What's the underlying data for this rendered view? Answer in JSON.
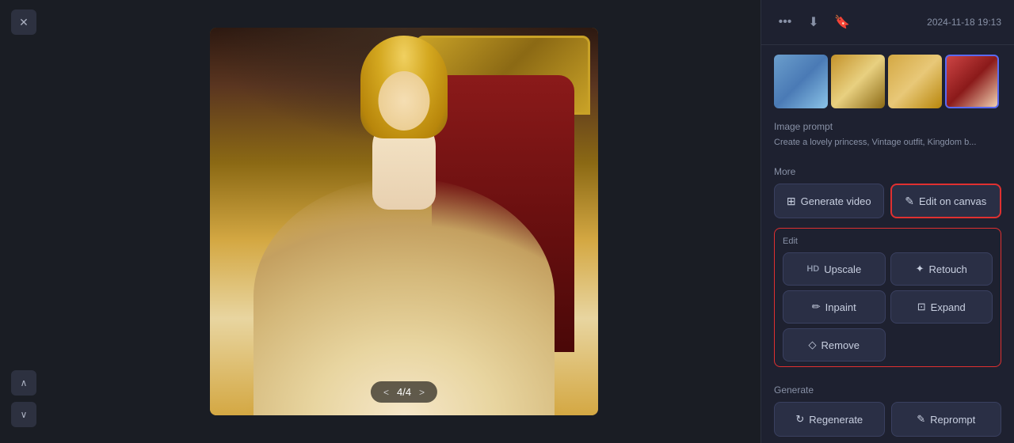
{
  "sidebar": {
    "close_label": "✕",
    "up_arrow": "∧",
    "down_arrow": "∨"
  },
  "header": {
    "timestamp": "2024-11-18 19:13",
    "more_icon": "•••",
    "download_icon": "⬇",
    "bookmark_icon": "🔖"
  },
  "thumbnails": [
    {
      "id": 1,
      "alt": "princess-blue-thumbnail"
    },
    {
      "id": 2,
      "alt": "princess-gold-thumbnail"
    },
    {
      "id": 3,
      "alt": "princess-yellow-thumbnail"
    },
    {
      "id": 4,
      "alt": "princess-red-thumbnail",
      "selected": true
    }
  ],
  "image_prompt": {
    "label": "Image prompt",
    "text": "Create a lovely princess, Vintage outfit, Kingdom b..."
  },
  "counter": {
    "current": "4",
    "total": "4",
    "prev": "<",
    "next": ">"
  },
  "more_section": {
    "label": "More",
    "generate_video_label": "Generate video",
    "generate_video_icon": "⊞",
    "edit_on_canvas_label": "Edit on canvas",
    "edit_on_canvas_icon": "✎"
  },
  "edit_section": {
    "label": "Edit",
    "buttons": [
      {
        "id": "upscale",
        "label": "Upscale",
        "icon": "HD"
      },
      {
        "id": "retouch",
        "label": "Retouch",
        "icon": "✦"
      },
      {
        "id": "inpaint",
        "label": "Inpaint",
        "icon": "✏"
      },
      {
        "id": "expand",
        "label": "Expand",
        "icon": "⊡"
      },
      {
        "id": "remove",
        "label": "Remove",
        "icon": "◇"
      }
    ]
  },
  "generate_section": {
    "label": "Generate",
    "buttons": [
      {
        "id": "regenerate",
        "label": "Regenerate",
        "icon": "↻"
      },
      {
        "id": "reprompt",
        "label": "Reprompt",
        "icon": "✎"
      }
    ]
  }
}
